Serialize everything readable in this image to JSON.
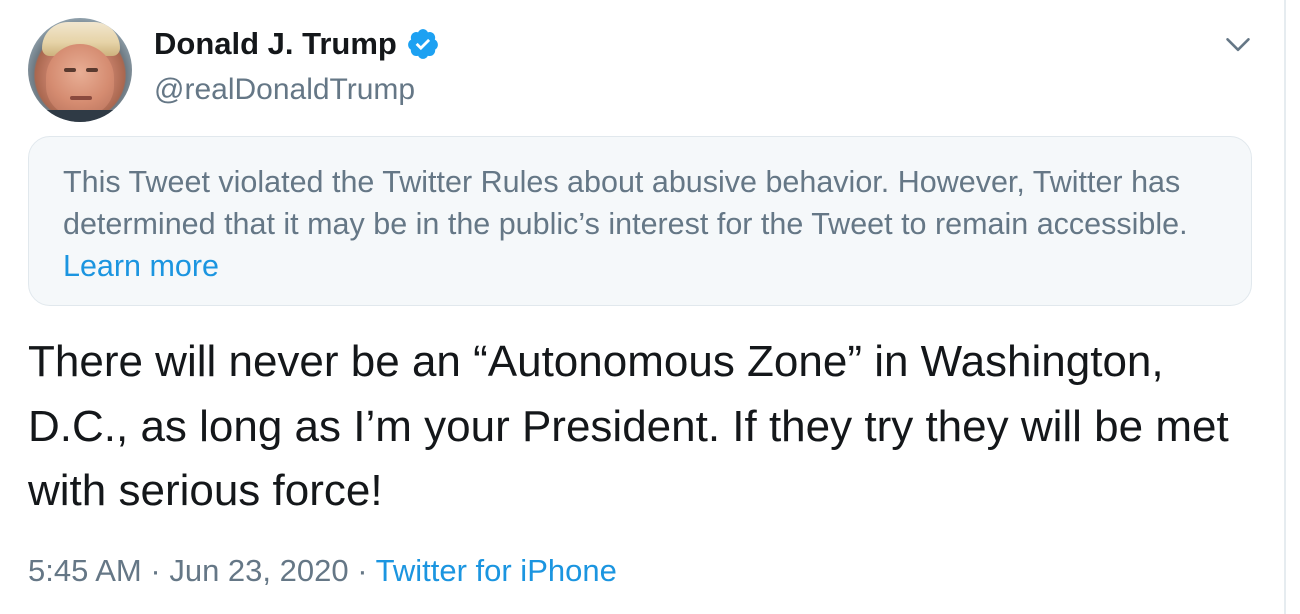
{
  "author": {
    "name": "Donald J. Trump",
    "handle": "@realDonaldTrump",
    "verified": true,
    "avatar_icon": "profile-photo"
  },
  "notice": {
    "text": "This Tweet violated the Twitter Rules about abusive behavior. However, Twitter has determined that it may be in the public’s interest for the Tweet to remain accessible.",
    "link_label": "Learn more"
  },
  "tweet": {
    "text": "There will never be an “Autonomous Zone” in Washington, D.C., as long as I’m your President. If they try they will be met with serious force!"
  },
  "meta": {
    "time": "5:45 AM",
    "separator": "·",
    "date": "Jun 23, 2020",
    "source": "Twitter for iPhone"
  },
  "colors": {
    "accent": "#1b95e0",
    "verified_badge": "#1da1f2",
    "muted_text": "#657786",
    "primary_text": "#14171a",
    "notice_bg": "#f5f8fa"
  },
  "icons": {
    "verified": "verified-badge-icon",
    "menu": "chevron-down-icon"
  }
}
